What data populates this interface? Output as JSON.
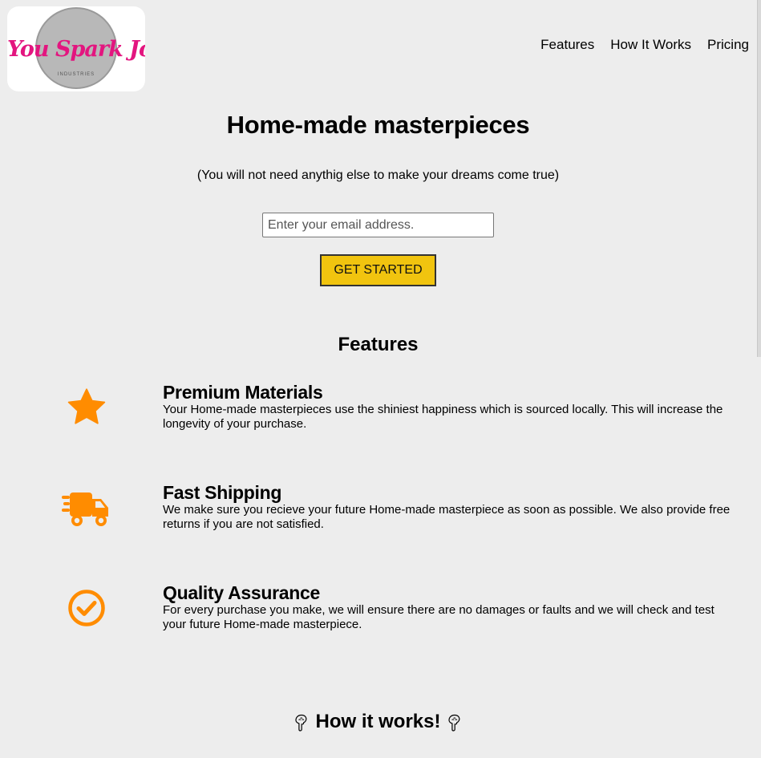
{
  "brand": {
    "logo_script": "You Spark Joy",
    "logo_subtitle": "INDUSTRIES",
    "accent": "#e3157f"
  },
  "nav": {
    "items": [
      "Features",
      "How It Works",
      "Pricing"
    ]
  },
  "hero": {
    "title": "Home-made masterpieces",
    "subtitle": "(You will not need anythig else to make your dreams come true)",
    "email_placeholder": "Enter your email address.",
    "cta_label": "GET STARTED",
    "cta_color": "#f1c40f"
  },
  "features": {
    "title": "Features",
    "icon_color": "#ff8c00",
    "items": [
      {
        "icon": "star-icon",
        "heading": "Premium Materials",
        "description": "Your Home-made masterpieces use the shiniest happiness which is sourced locally. This will increase the longevity of your purchase."
      },
      {
        "icon": "truck-icon",
        "heading": "Fast Shipping",
        "description": "We make sure you recieve your future Home-made masterpiece as soon as possible. We also provide free returns if you are not satisfied."
      },
      {
        "icon": "check-circle-icon",
        "heading": "Quality Assurance",
        "description": "For every purchase you make, we will ensure there are no damages or faults and we will check and test your future Home-made masterpiece."
      }
    ]
  },
  "how": {
    "title": "How it works!",
    "icon": "pointing-down-icon"
  }
}
